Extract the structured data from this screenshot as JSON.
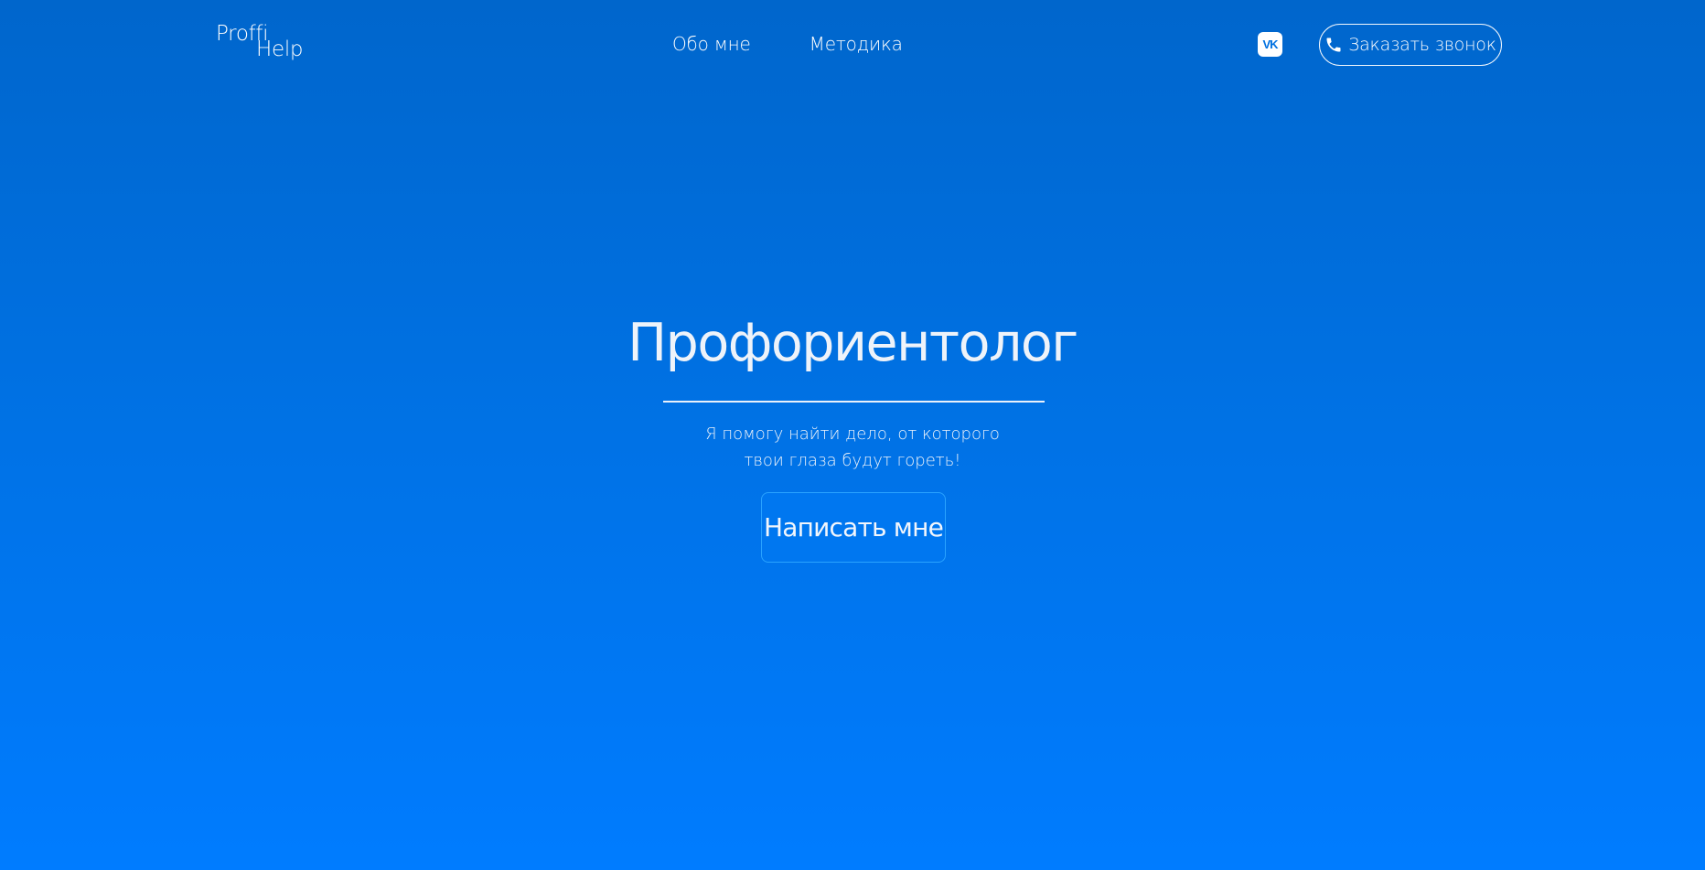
{
  "header": {
    "logo": {
      "line1": "Proffi",
      "line2": "Help"
    },
    "nav": [
      {
        "label": "Обо мне"
      },
      {
        "label": "Методика"
      }
    ],
    "social": {
      "icon": "vk-icon",
      "label": "VK"
    },
    "call_button": {
      "icon": "phone-icon",
      "label": "Заказать звонок"
    }
  },
  "hero": {
    "title": "Профориентолог",
    "subtitle_line1": "Я помогу найти дело, от которого",
    "subtitle_line2": "твои глаза будут гореть!",
    "cta_label": "Написать мне"
  },
  "colors": {
    "background_top": "#0066cc",
    "background_bottom": "#007cff",
    "text": "#ffffff",
    "cta_border": "#2aa3ff"
  }
}
